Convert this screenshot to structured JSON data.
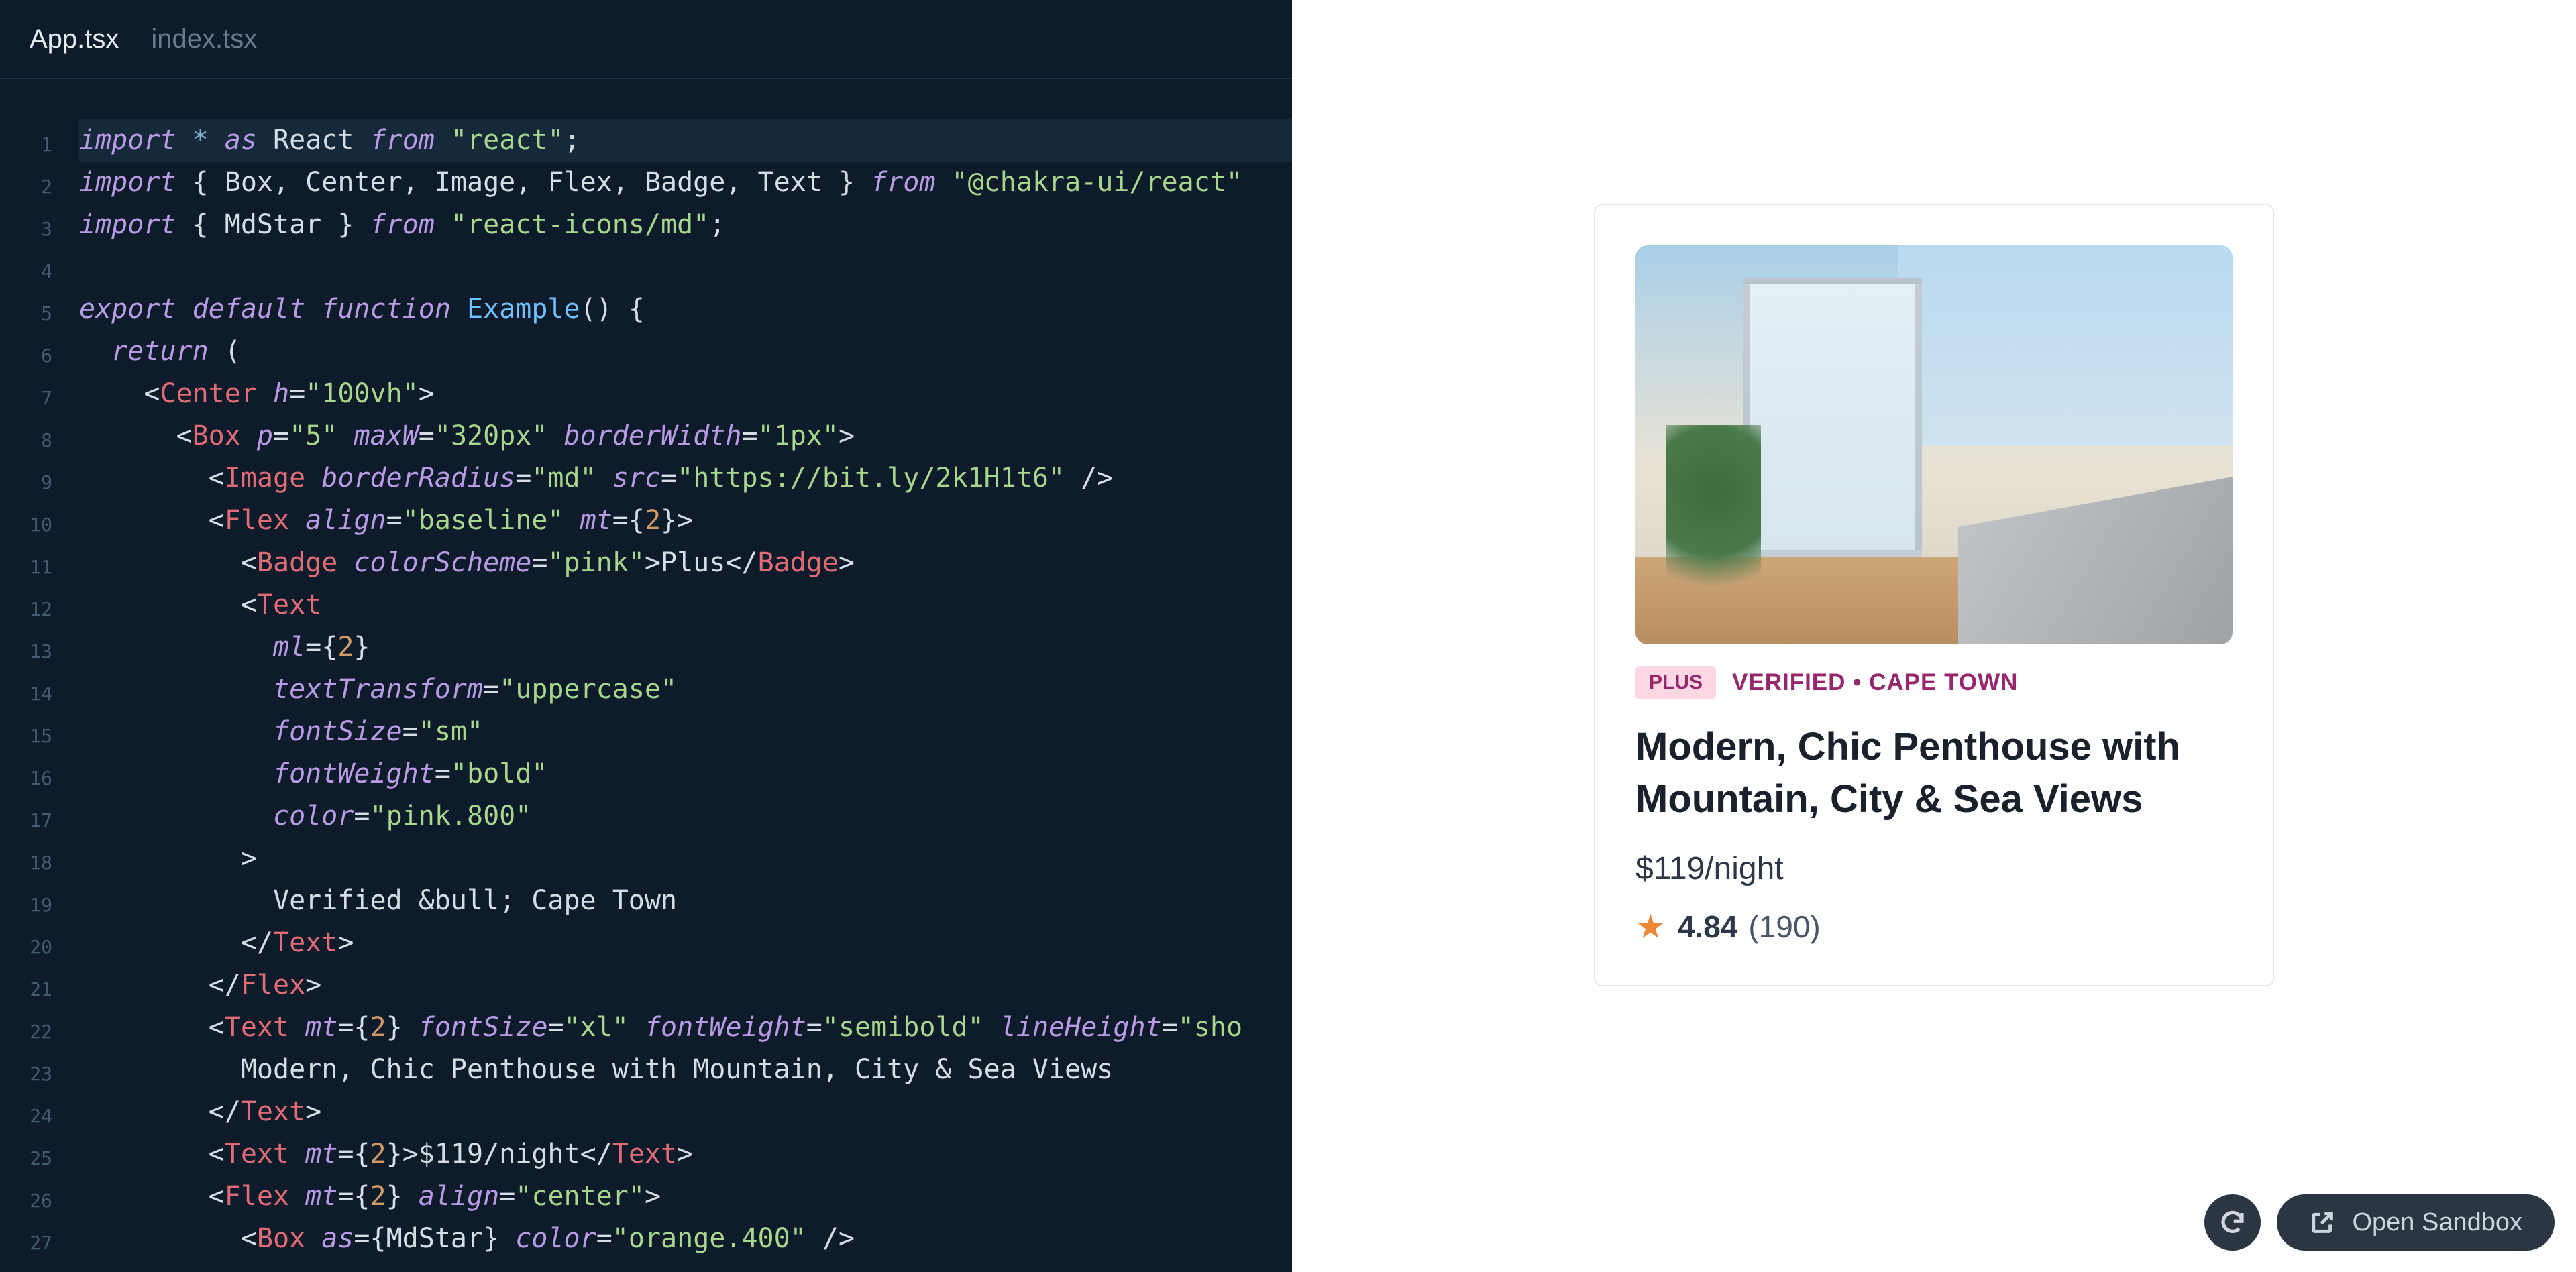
{
  "tabs": [
    {
      "label": "App.tsx",
      "active": true
    },
    {
      "label": "index.tsx",
      "active": false
    }
  ],
  "code_lines": [
    {
      "n": 1,
      "hl": true,
      "tokens": [
        [
          "k",
          "import"
        ],
        [
          "p",
          " "
        ],
        [
          "o",
          "*"
        ],
        [
          "p",
          " "
        ],
        [
          "k",
          "as"
        ],
        [
          "p",
          " "
        ],
        [
          "id",
          "React"
        ],
        [
          "p",
          " "
        ],
        [
          "k",
          "from"
        ],
        [
          "p",
          " "
        ],
        [
          "s",
          "\"react\""
        ],
        [
          "p",
          ";"
        ]
      ]
    },
    {
      "n": 2,
      "tokens": [
        [
          "k",
          "import"
        ],
        [
          "p",
          " { "
        ],
        [
          "id",
          "Box"
        ],
        [
          "p",
          ", "
        ],
        [
          "id",
          "Center"
        ],
        [
          "p",
          ", "
        ],
        [
          "id",
          "Image"
        ],
        [
          "p",
          ", "
        ],
        [
          "id",
          "Flex"
        ],
        [
          "p",
          ", "
        ],
        [
          "id",
          "Badge"
        ],
        [
          "p",
          ", "
        ],
        [
          "id",
          "Text"
        ],
        [
          "p",
          " } "
        ],
        [
          "k",
          "from"
        ],
        [
          "p",
          " "
        ],
        [
          "s",
          "\"@chakra-ui/react\""
        ]
      ]
    },
    {
      "n": 3,
      "tokens": [
        [
          "k",
          "import"
        ],
        [
          "p",
          " { "
        ],
        [
          "id",
          "MdStar"
        ],
        [
          "p",
          " } "
        ],
        [
          "k",
          "from"
        ],
        [
          "p",
          " "
        ],
        [
          "s",
          "\"react-icons/md\""
        ],
        [
          "p",
          ";"
        ]
      ]
    },
    {
      "n": 4,
      "tokens": []
    },
    {
      "n": 5,
      "tokens": [
        [
          "k",
          "export"
        ],
        [
          "p",
          " "
        ],
        [
          "k",
          "default"
        ],
        [
          "p",
          " "
        ],
        [
          "k",
          "function"
        ],
        [
          "p",
          " "
        ],
        [
          "fn",
          "Example"
        ],
        [
          "p",
          "() {"
        ]
      ]
    },
    {
      "n": 6,
      "tokens": [
        [
          "p",
          "  "
        ],
        [
          "k",
          "return"
        ],
        [
          "p",
          " ("
        ]
      ]
    },
    {
      "n": 7,
      "tokens": [
        [
          "p",
          "    <"
        ],
        [
          "t",
          "Center"
        ],
        [
          "p",
          " "
        ],
        [
          "attr",
          "h"
        ],
        [
          "p",
          "="
        ],
        [
          "s",
          "\"100vh\""
        ],
        [
          "p",
          ">"
        ]
      ]
    },
    {
      "n": 8,
      "tokens": [
        [
          "p",
          "      <"
        ],
        [
          "t",
          "Box"
        ],
        [
          "p",
          " "
        ],
        [
          "attr",
          "p"
        ],
        [
          "p",
          "="
        ],
        [
          "s",
          "\"5\""
        ],
        [
          "p",
          " "
        ],
        [
          "attr",
          "maxW"
        ],
        [
          "p",
          "="
        ],
        [
          "s",
          "\"320px\""
        ],
        [
          "p",
          " "
        ],
        [
          "attr",
          "borderWidth"
        ],
        [
          "p",
          "="
        ],
        [
          "s",
          "\"1px\""
        ],
        [
          "p",
          ">"
        ]
      ]
    },
    {
      "n": 9,
      "tokens": [
        [
          "p",
          "        <"
        ],
        [
          "t",
          "Image"
        ],
        [
          "p",
          " "
        ],
        [
          "attr",
          "borderRadius"
        ],
        [
          "p",
          "="
        ],
        [
          "s",
          "\"md\""
        ],
        [
          "p",
          " "
        ],
        [
          "attr",
          "src"
        ],
        [
          "p",
          "="
        ],
        [
          "s",
          "\"https://bit.ly/2k1H1t6\""
        ],
        [
          "p",
          " />"
        ]
      ]
    },
    {
      "n": 10,
      "tokens": [
        [
          "p",
          "        <"
        ],
        [
          "t",
          "Flex"
        ],
        [
          "p",
          " "
        ],
        [
          "attr",
          "align"
        ],
        [
          "p",
          "="
        ],
        [
          "s",
          "\"baseline\""
        ],
        [
          "p",
          " "
        ],
        [
          "attr",
          "mt"
        ],
        [
          "p",
          "={"
        ],
        [
          "num",
          "2"
        ],
        [
          "p",
          "}>"
        ]
      ]
    },
    {
      "n": 11,
      "tokens": [
        [
          "p",
          "          <"
        ],
        [
          "t",
          "Badge"
        ],
        [
          "p",
          " "
        ],
        [
          "attr",
          "colorScheme"
        ],
        [
          "p",
          "="
        ],
        [
          "s",
          "\"pink\""
        ],
        [
          "p",
          ">Plus</"
        ],
        [
          "t",
          "Badge"
        ],
        [
          "p",
          ">"
        ]
      ]
    },
    {
      "n": 12,
      "tokens": [
        [
          "p",
          "          <"
        ],
        [
          "t",
          "Text"
        ]
      ]
    },
    {
      "n": 13,
      "tokens": [
        [
          "p",
          "            "
        ],
        [
          "attr",
          "ml"
        ],
        [
          "p",
          "={"
        ],
        [
          "num",
          "2"
        ],
        [
          "p",
          "}"
        ]
      ]
    },
    {
      "n": 14,
      "tokens": [
        [
          "p",
          "            "
        ],
        [
          "attr",
          "textTransform"
        ],
        [
          "p",
          "="
        ],
        [
          "s",
          "\"uppercase\""
        ]
      ]
    },
    {
      "n": 15,
      "tokens": [
        [
          "p",
          "            "
        ],
        [
          "attr",
          "fontSize"
        ],
        [
          "p",
          "="
        ],
        [
          "s",
          "\"sm\""
        ]
      ]
    },
    {
      "n": 16,
      "tokens": [
        [
          "p",
          "            "
        ],
        [
          "attr",
          "fontWeight"
        ],
        [
          "p",
          "="
        ],
        [
          "s",
          "\"bold\""
        ]
      ]
    },
    {
      "n": 17,
      "tokens": [
        [
          "p",
          "            "
        ],
        [
          "attr",
          "color"
        ],
        [
          "p",
          "="
        ],
        [
          "s",
          "\"pink.800\""
        ]
      ]
    },
    {
      "n": 18,
      "tokens": [
        [
          "p",
          "          >"
        ]
      ]
    },
    {
      "n": 19,
      "tokens": [
        [
          "p",
          "            Verified &bull; Cape Town"
        ]
      ]
    },
    {
      "n": 20,
      "tokens": [
        [
          "p",
          "          </"
        ],
        [
          "t",
          "Text"
        ],
        [
          "p",
          ">"
        ]
      ]
    },
    {
      "n": 21,
      "tokens": [
        [
          "p",
          "        </"
        ],
        [
          "t",
          "Flex"
        ],
        [
          "p",
          ">"
        ]
      ]
    },
    {
      "n": 22,
      "tokens": [
        [
          "p",
          "        <"
        ],
        [
          "t",
          "Text"
        ],
        [
          "p",
          " "
        ],
        [
          "attr",
          "mt"
        ],
        [
          "p",
          "={"
        ],
        [
          "num",
          "2"
        ],
        [
          "p",
          "} "
        ],
        [
          "attr",
          "fontSize"
        ],
        [
          "p",
          "="
        ],
        [
          "s",
          "\"xl\""
        ],
        [
          "p",
          " "
        ],
        [
          "attr",
          "fontWeight"
        ],
        [
          "p",
          "="
        ],
        [
          "s",
          "\"semibold\""
        ],
        [
          "p",
          " "
        ],
        [
          "attr",
          "lineHeight"
        ],
        [
          "p",
          "="
        ],
        [
          "s",
          "\"sho"
        ]
      ]
    },
    {
      "n": 23,
      "tokens": [
        [
          "p",
          "          Modern, Chic Penthouse with Mountain, City & Sea Views"
        ]
      ]
    },
    {
      "n": 24,
      "tokens": [
        [
          "p",
          "        </"
        ],
        [
          "t",
          "Text"
        ],
        [
          "p",
          ">"
        ]
      ]
    },
    {
      "n": 25,
      "tokens": [
        [
          "p",
          "        <"
        ],
        [
          "t",
          "Text"
        ],
        [
          "p",
          " "
        ],
        [
          "attr",
          "mt"
        ],
        [
          "p",
          "={"
        ],
        [
          "num",
          "2"
        ],
        [
          "p",
          "}>$119/night</"
        ],
        [
          "t",
          "Text"
        ],
        [
          "p",
          ">"
        ]
      ]
    },
    {
      "n": 26,
      "tokens": [
        [
          "p",
          "        <"
        ],
        [
          "t",
          "Flex"
        ],
        [
          "p",
          " "
        ],
        [
          "attr",
          "mt"
        ],
        [
          "p",
          "={"
        ],
        [
          "num",
          "2"
        ],
        [
          "p",
          "} "
        ],
        [
          "attr",
          "align"
        ],
        [
          "p",
          "="
        ],
        [
          "s",
          "\"center\""
        ],
        [
          "p",
          ">"
        ]
      ]
    },
    {
      "n": 27,
      "tokens": [
        [
          "p",
          "          <"
        ],
        [
          "t",
          "Box"
        ],
        [
          "p",
          " "
        ],
        [
          "attr",
          "as"
        ],
        [
          "p",
          "={"
        ],
        [
          "id",
          "MdStar"
        ],
        [
          "p",
          "} "
        ],
        [
          "attr",
          "color"
        ],
        [
          "p",
          "="
        ],
        [
          "s",
          "\"orange.400\""
        ],
        [
          "p",
          " />"
        ]
      ]
    }
  ],
  "preview": {
    "badge": "PLUS",
    "meta": "VERIFIED • CAPE TOWN",
    "title": "Modern, Chic Penthouse with Mountain, City & Sea Views",
    "price": "$119/night",
    "rating": "4.84",
    "reviews": "(190)"
  },
  "toolbar": {
    "open_sandbox": "Open Sandbox"
  }
}
